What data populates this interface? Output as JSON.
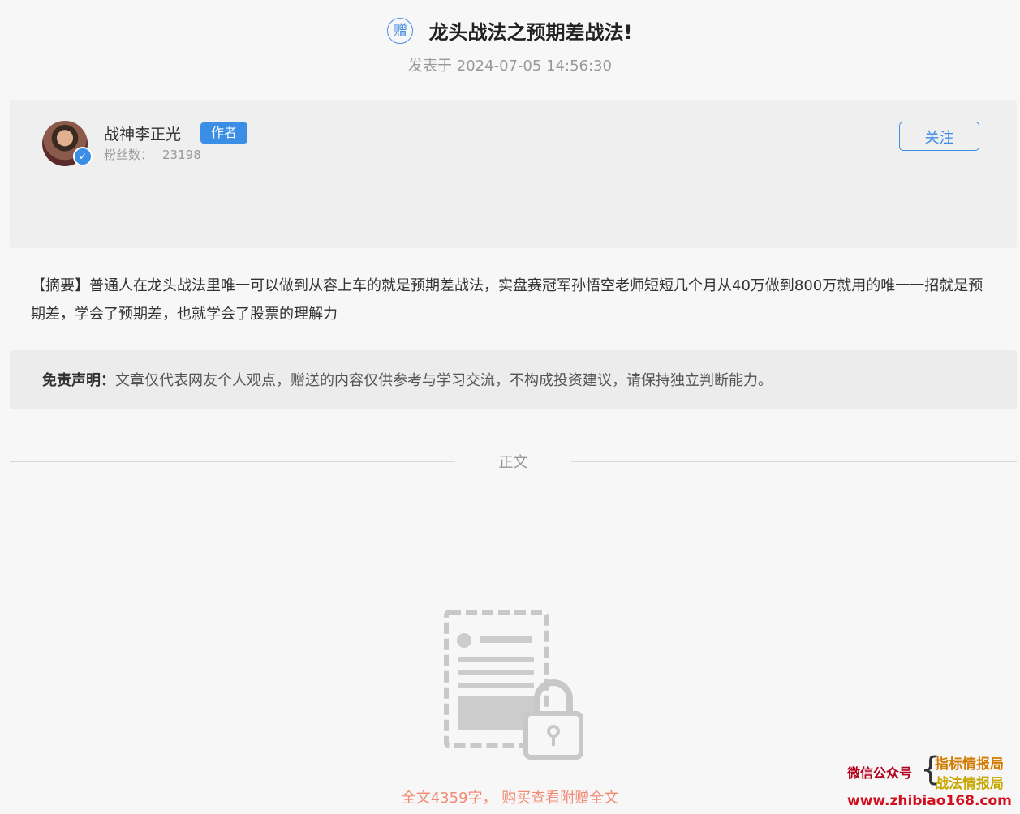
{
  "header": {
    "badge_text": "赠",
    "title": "龙头战法之预期差战法!",
    "published": "发表于 2024-07-05 14:56:30"
  },
  "author": {
    "name": "战神李正光",
    "role_badge": "作者",
    "fans_label": "粉丝数：",
    "fans_count": "23198",
    "follow_label": "关注",
    "verified_icon": "✓"
  },
  "summary": {
    "text": "【摘要】普通人在龙头战法里唯一可以做到从容上车的就是预期差战法，实盘赛冠军孙悟空老师短短几个月从40万做到800万就用的唯一一招就是预期差，学会了预期差，也就学会了股票的理解力"
  },
  "disclaimer": {
    "label": "免责声明：",
    "text": "文章仅代表网友个人观点，赠送的内容仅供参考与学习交流，不构成投资建议，请保持独立判断能力。"
  },
  "section": {
    "label": "正文"
  },
  "locked": {
    "icon": "locked-document-icon",
    "purchase_text": "全文4359字， 购买查看附赠全文"
  },
  "watermark": {
    "account_label": "微信公众号",
    "name_1": "指标情报局",
    "name_2": "战法情报局",
    "url": "www.zhibiao168.com"
  },
  "colors": {
    "accent": "#3a8ee6",
    "purchase_text": "#f28a73",
    "background": "#f7f7f7"
  }
}
